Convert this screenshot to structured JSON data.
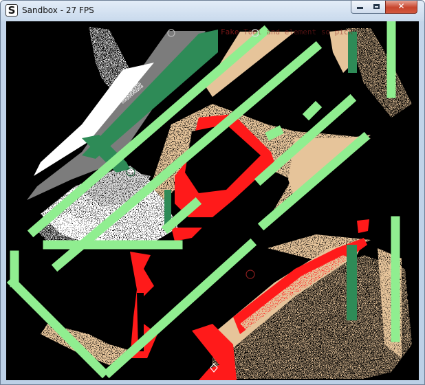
{
  "window": {
    "icon_letter": "S",
    "title": "Sandbox - 27 FPS",
    "controls": {
      "minimize": "",
      "maximize": "",
      "close": "✕"
    }
  },
  "hud": {
    "label": "Fake",
    "text": "Tool and element so pick"
  },
  "scene": {
    "background": "#000000",
    "materials": {
      "glass": "#90ee90",
      "plant": "#2e8b57",
      "sand": "#e6c49a",
      "stone": "#7a7a7a",
      "snow": "#ffffff",
      "fire": "#ff1a1a"
    },
    "markers": [
      "ring-icon",
      "ring-icon",
      "ring-icon",
      "ring-icon",
      "diamond-icon"
    ]
  }
}
